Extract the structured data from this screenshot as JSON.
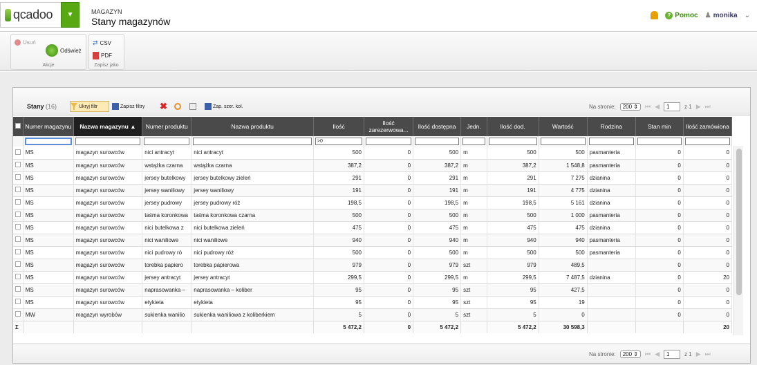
{
  "app": {
    "logo": "qcadoo",
    "breadcrumb": "MAGAZYN",
    "title": "Stany magazynów",
    "help": "Pomoc",
    "user": "monika"
  },
  "ribbon": {
    "actions": {
      "label": "Akcje",
      "delete": "Usuń",
      "refresh": "Odśwież"
    },
    "save": {
      "label": "Zapisz jako",
      "csv": "CSV",
      "pdf": "PDF"
    }
  },
  "grid": {
    "title": "Stany",
    "count": "(16)",
    "hide_filter": "Ukryj filtr",
    "save_filters": "Zapisz filtry",
    "save_widths": "Zap. szer. kol.",
    "per_page_label": "Na stronie:",
    "per_page": "200",
    "page": "1",
    "page_of": "z 1",
    "columns": [
      "Numer magazynu",
      "Nazwa magazynu",
      "Numer produktu",
      "Nazwa produktu",
      "Ilość",
      "Ilość zarezerwowa...",
      "Ilość dostępna",
      "Jedn.",
      "Ilość dod.",
      "Wartość",
      "Rodzina",
      "Stan min",
      "Ilość zamówiona"
    ],
    "sort_indicator": "▲",
    "filter_ilosc": ">0",
    "rows": [
      [
        "MS",
        "magazyn surowców",
        "nici antracyt",
        "nici antracyt",
        "500",
        "0",
        "500",
        "m",
        "500",
        "500",
        "pasmanteria",
        "0",
        "0"
      ],
      [
        "MS",
        "magazyn surowców",
        "wstążka czarna",
        "wstążka czarna",
        "387,2",
        "0",
        "387,2",
        "m",
        "387,2",
        "1 548,8",
        "pasmanteria",
        "0",
        "0"
      ],
      [
        "MS",
        "magazyn surowców",
        "jersey butelkowy",
        "jersey butelkowy zieleń",
        "291",
        "0",
        "291",
        "m",
        "291",
        "7 275",
        "dzianina",
        "0",
        "0"
      ],
      [
        "MS",
        "magazyn surowców",
        "jersey waniliowy",
        "jersey waniliowy",
        "191",
        "0",
        "191",
        "m",
        "191",
        "4 775",
        "dzianina",
        "0",
        "0"
      ],
      [
        "MS",
        "magazyn surowców",
        "jersey pudrowy",
        "jersey pudrowy róż",
        "198,5",
        "0",
        "198,5",
        "m",
        "198,5",
        "5 161",
        "dzianina",
        "0",
        "0"
      ],
      [
        "MS",
        "magazyn surowców",
        "taśma koronkowa",
        "taśma koronkowa czarna",
        "500",
        "0",
        "500",
        "m",
        "500",
        "1 000",
        "pasmanteria",
        "0",
        "0"
      ],
      [
        "MS",
        "magazyn surowców",
        "nici butelkowa z",
        "nici butelkowa zieleń",
        "475",
        "0",
        "475",
        "m",
        "475",
        "475",
        "dzianina",
        "0",
        "0"
      ],
      [
        "MS",
        "magazyn surowców",
        "nici waniliowe",
        "nici waniliowe",
        "940",
        "0",
        "940",
        "m",
        "940",
        "940",
        "pasmanteria",
        "0",
        "0"
      ],
      [
        "MS",
        "magazyn surowców",
        "nici pudrowy ró",
        "nici pudrowy róż",
        "500",
        "0",
        "500",
        "m",
        "500",
        "500",
        "pasmanteria",
        "0",
        "0"
      ],
      [
        "MS",
        "magazyn surowców",
        "torebka papiero",
        "torebka papierowa",
        "979",
        "0",
        "979",
        "szt",
        "979",
        "489,5",
        "",
        "0",
        "0"
      ],
      [
        "MS",
        "magazyn surowców",
        "jersey antracyt",
        "jersey antracyt",
        "299,5",
        "0",
        "299,5",
        "m",
        "299,5",
        "7 487,5",
        "dzianina",
        "0",
        "20"
      ],
      [
        "MS",
        "magazyn surowców",
        "naprasowanka –",
        "naprasowanka – koliber",
        "95",
        "0",
        "95",
        "szt",
        "95",
        "427,5",
        "",
        "0",
        "0"
      ],
      [
        "MS",
        "magazyn surowców",
        "etykieta",
        "etykieta",
        "95",
        "0",
        "95",
        "szt",
        "95",
        "19",
        "",
        "0",
        "0"
      ],
      [
        "MW",
        "magazyn wyrobów",
        "sukienka wanilio",
        "sukienka waniliowa z koliberkiem",
        "5",
        "0",
        "5",
        "szt",
        "5",
        "0",
        "",
        "0",
        "0"
      ]
    ],
    "sum": {
      "symbol": "Σ",
      "ilosc": "5 472,2",
      "zarez": "0",
      "dostepna": "5 472,2",
      "dod": "5 472,2",
      "wartosc": "30 598,3",
      "zamowiona": "20"
    }
  }
}
